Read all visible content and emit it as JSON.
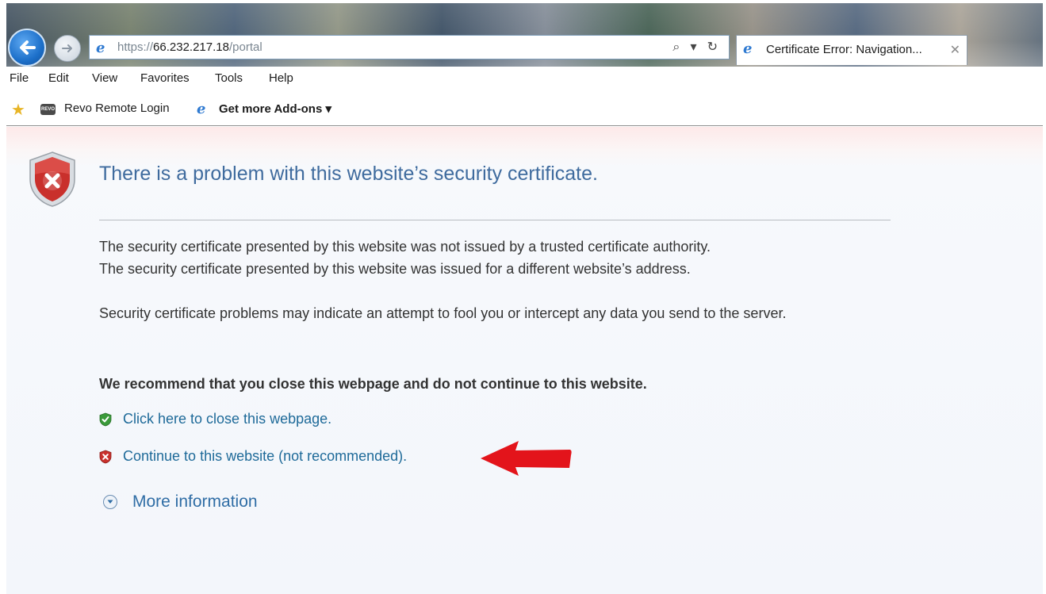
{
  "browser": {
    "address": {
      "scheme": "https://",
      "host": "66.232.217.18",
      "path": "/portal",
      "tools": "⌕ ▾ ↻"
    },
    "tab": {
      "title": "Certificate Error: Navigation...",
      "close": "✕"
    },
    "menu": [
      "File",
      "Edit",
      "View",
      "Favorites",
      "Tools",
      "Help"
    ],
    "favorites": {
      "revo_icon_text": "REVO",
      "revo_label": "Revo Remote Login",
      "addons_label": "Get more Add-ons ▾"
    }
  },
  "page": {
    "headline": "There is a problem with this website’s security certificate.",
    "para1": "The security certificate presented by this website was not issued by a trusted certificate authority.",
    "para2": "The security certificate presented by this website was issued for a different website’s address.",
    "para3": "Security certificate problems may indicate an attempt to fool you or intercept any data you send to the server.",
    "recommend": "We recommend that you close this webpage and do not continue to this website.",
    "close_link": "Click here to close this webpage.",
    "continue_link": "Continue to this website (not recommended).",
    "more_info": "More information"
  },
  "colors": {
    "headline": "#3f6b9e",
    "link": "#1e6a99",
    "shield_red": "#c9302c",
    "shield_green": "#3a9a3a",
    "annotation_arrow": "#e3141b"
  },
  "icons": {
    "back": "back-arrow-icon",
    "forward": "forward-arrow-icon",
    "ie": "internet-explorer-icon",
    "favorites": "favorites-star-icon",
    "error_shield": "error-shield-icon",
    "ok_shield": "green-shield-icon",
    "more": "chevron-down-circle-icon"
  }
}
